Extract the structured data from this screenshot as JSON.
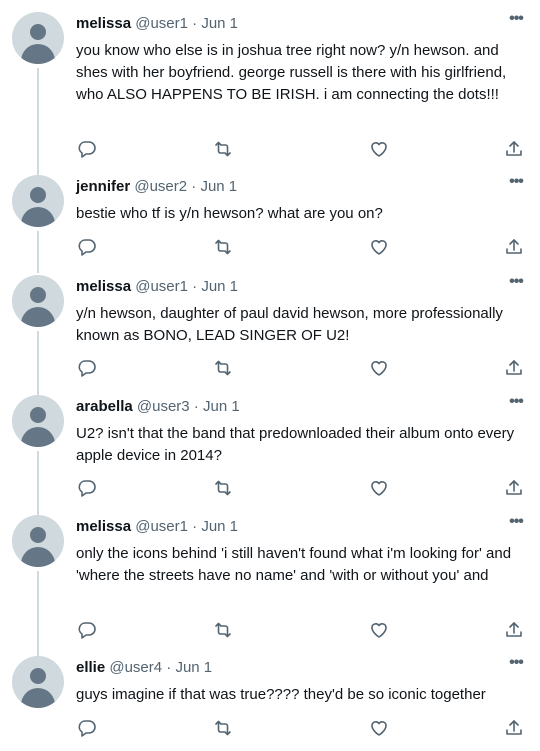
{
  "tweets": [
    {
      "name": "melissa",
      "handle": "@user1",
      "date": "Jun 1",
      "text": "you know who else is in joshua tree right now? y/n hewson. and shes with her boyfriend. george russell is there with his girlfriend, who ALSO HAPPENS TO BE IRISH. i am connecting the dots!!!"
    },
    {
      "name": "jennifer",
      "handle": "@user2",
      "date": "Jun 1",
      "text": "bestie who tf is y/n hewson? what are you on?"
    },
    {
      "name": "melissa",
      "handle": "@user1",
      "date": "Jun 1",
      "text": "y/n hewson, daughter of paul david hewson, more professionally known as BONO, LEAD SINGER OF U2!"
    },
    {
      "name": "arabella",
      "handle": "@user3",
      "date": "Jun 1",
      "text": "U2? isn't that the band that predownloaded their album onto every apple device in 2014?"
    },
    {
      "name": "melissa",
      "handle": "@user1",
      "date": "Jun 1",
      "text": "only the icons behind 'i still haven't found what i'm looking for' and 'where the streets have no name' and 'with or without you' and"
    },
    {
      "name": "ellie",
      "handle": "@user4",
      "date": "Jun 1",
      "text": "guys imagine if that was true???? they'd be so iconic together"
    }
  ],
  "separator": " · ",
  "more_glyph": "•••",
  "icons": [
    "reply-icon",
    "retweet-icon",
    "like-icon",
    "share-icon",
    "more-icon",
    "avatar-icon"
  ],
  "colors": {
    "text": "#0f1419",
    "secondary": "#536471",
    "avatar_bg": "#cfd9de",
    "avatar_fg": "#657786",
    "thread_line": "#cfd9de"
  }
}
